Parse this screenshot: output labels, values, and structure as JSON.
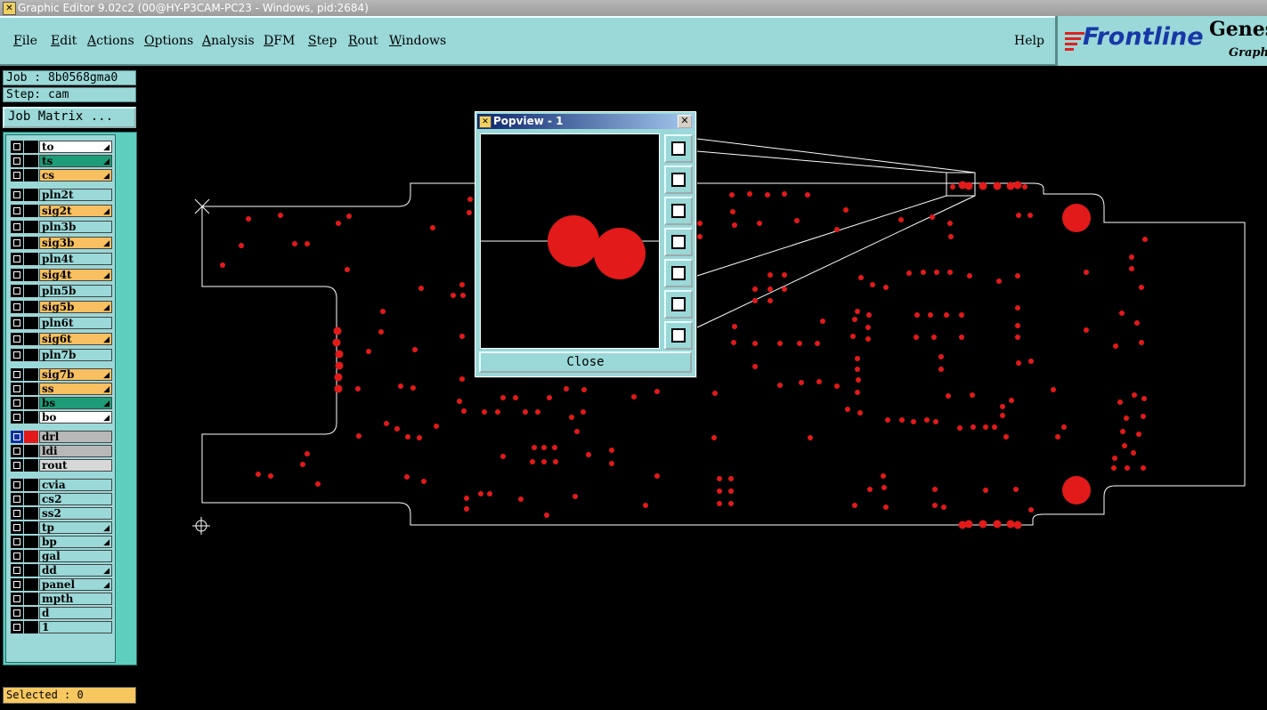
{
  "window": {
    "title": "Graphic Editor 9.02c2 (00@HY-P3CAM-PC23 - Windows, pid:2684)"
  },
  "menu": {
    "items": [
      {
        "label": "File",
        "u": "F",
        "rest": "ile"
      },
      {
        "label": "Edit",
        "u": "E",
        "rest": "dit"
      },
      {
        "label": "Actions",
        "u": "A",
        "rest": "ctions"
      },
      {
        "label": "Options",
        "u": "O",
        "rest": "ptions"
      },
      {
        "label": "Analysis",
        "u": "A",
        "rest": "nalysis"
      },
      {
        "label": "DFM",
        "u": "D",
        "rest": "FM"
      },
      {
        "label": "Step",
        "u": "S",
        "rest": "tep"
      },
      {
        "label": "Rout",
        "u": "R",
        "rest": "out"
      },
      {
        "label": "Windows",
        "u": "W",
        "rest": "indows"
      }
    ],
    "help": "Help"
  },
  "logo": {
    "frontline": "Frontline",
    "genesis": "Genesis",
    "graphic": "Graphic"
  },
  "job": {
    "label": "Job : 8b0568gma0",
    "step": "Step: cam",
    "matrix_button": "Job Matrix ..."
  },
  "layers": [
    {
      "name": "to",
      "color": "#ffffff",
      "arrow": true
    },
    {
      "name": "ts",
      "color": "#1e9c78",
      "arrow": true
    },
    {
      "name": "cs",
      "color": "#f8c060",
      "arrow": true
    },
    {
      "name": "pln2t",
      "color": "#9bd8d8",
      "arrow": false
    },
    {
      "name": "sig2t",
      "color": "#f8c060",
      "arrow": true
    },
    {
      "name": "pln3b",
      "color": "#9bd8d8",
      "arrow": false
    },
    {
      "name": "sig3b",
      "color": "#f8c060",
      "arrow": true
    },
    {
      "name": "pln4t",
      "color": "#9bd8d8",
      "arrow": false
    },
    {
      "name": "sig4t",
      "color": "#f8c060",
      "arrow": true
    },
    {
      "name": "pln5b",
      "color": "#9bd8d8",
      "arrow": false
    },
    {
      "name": "sig5b",
      "color": "#f8c060",
      "arrow": true
    },
    {
      "name": "pln6t",
      "color": "#9bd8d8",
      "arrow": false
    },
    {
      "name": "sig6t",
      "color": "#f8c060",
      "arrow": true
    },
    {
      "name": "pln7b",
      "color": "#9bd8d8",
      "arrow": false
    },
    {
      "name": "sig7b",
      "color": "#f8c060",
      "arrow": true
    },
    {
      "name": "ss",
      "color": "#f8c060",
      "arrow": true
    },
    {
      "name": "bs",
      "color": "#1e9c78",
      "arrow": true
    },
    {
      "name": "bo",
      "color": "#ffffff",
      "arrow": true
    },
    {
      "name": "drl",
      "color": "#b8b8b8",
      "arrow": false,
      "active": true
    },
    {
      "name": "ldi",
      "color": "#b8b8b8",
      "arrow": false
    },
    {
      "name": "rout",
      "color": "#d8d8d8",
      "arrow": false
    },
    {
      "name": "cvia",
      "color": "#9bd8d8",
      "arrow": false
    },
    {
      "name": "cs2",
      "color": "#9bd8d8",
      "arrow": false
    },
    {
      "name": "ss2",
      "color": "#9bd8d8",
      "arrow": false
    },
    {
      "name": "tp",
      "color": "#9bd8d8",
      "arrow": true
    },
    {
      "name": "bp",
      "color": "#9bd8d8",
      "arrow": true
    },
    {
      "name": "gal",
      "color": "#9bd8d8",
      "arrow": false
    },
    {
      "name": "dd",
      "color": "#9bd8d8",
      "arrow": true
    },
    {
      "name": "panel",
      "color": "#9bd8d8",
      "arrow": true
    },
    {
      "name": "mpth",
      "color": "#9bd8d8",
      "arrow": false
    },
    {
      "name": "d",
      "color": "#9bd8d8",
      "arrow": false
    },
    {
      "name": "1",
      "color": "#9bd8d8",
      "arrow": false
    }
  ],
  "status": {
    "selected": "Selected : 0"
  },
  "popview": {
    "title": "Popview - 1",
    "close_label": "Close",
    "close_x": "✕"
  },
  "colors": {
    "pad": "#e21a1a",
    "outline": "#ffffff",
    "panel": "#9bd8d8"
  }
}
